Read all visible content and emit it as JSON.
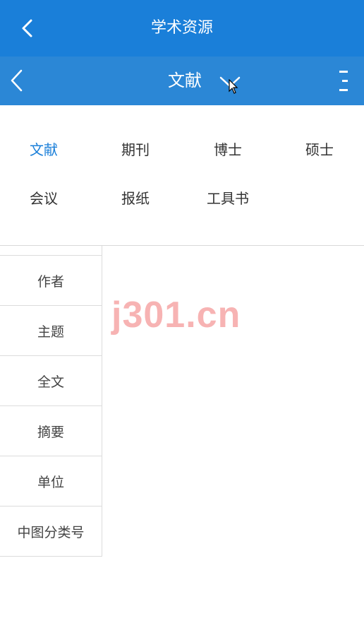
{
  "header": {
    "title": "学术资源"
  },
  "subheader": {
    "title": "文献"
  },
  "categories": [
    {
      "label": "文献",
      "active": true
    },
    {
      "label": "期刊"
    },
    {
      "label": "博士"
    },
    {
      "label": "硕士"
    },
    {
      "label": "会议"
    },
    {
      "label": "报纸"
    },
    {
      "label": "工具书"
    }
  ],
  "search_fields": [
    "作者",
    "主题",
    "全文",
    "摘要",
    "单位",
    "中图分类号"
  ],
  "watermark": "j301.cn",
  "colors": {
    "header_bg": "#1a7fd9",
    "subheader_bg": "#2b87d6",
    "active": "#1a7fd9",
    "watermark": "#f7b3b3"
  },
  "icons": [
    "back-arrow-icon",
    "chevron-down-icon",
    "more-vertical-icon",
    "mouse-cursor-icon"
  ]
}
